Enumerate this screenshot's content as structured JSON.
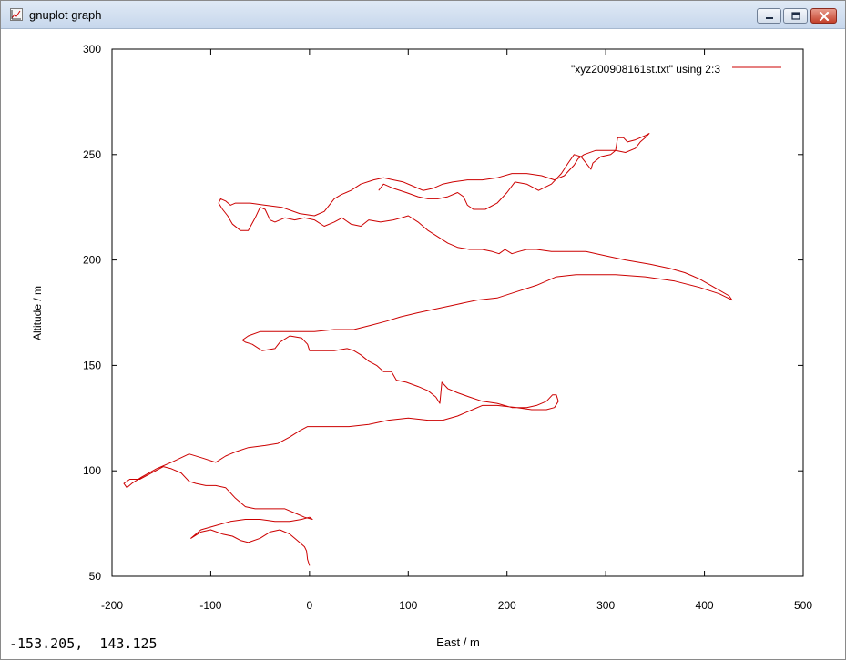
{
  "window": {
    "title": "gnuplot graph",
    "icon": "gnuplot-graph-icon",
    "controls": [
      "minimize-icon",
      "maximize-icon",
      "close-icon"
    ]
  },
  "status": {
    "mouse_coords": "-153.205,  143.125"
  },
  "chart_data": {
    "type": "line",
    "xlabel": "East / m",
    "ylabel": "Altitude / m",
    "xlim": [
      -200,
      500
    ],
    "ylim": [
      50,
      300
    ],
    "x_ticks": [
      "-200",
      "-100",
      "0",
      "100",
      "200",
      "300",
      "400",
      "500"
    ],
    "y_ticks": [
      "50",
      "100",
      "150",
      "200",
      "250",
      "300"
    ],
    "grid": false,
    "legend_position": "top-right",
    "series": [
      {
        "name": "\"xyz200908161st.txt\" using 2:3",
        "color": "#cc0000",
        "points": [
          [
            0,
            55
          ],
          [
            -2,
            58
          ],
          [
            -3,
            62
          ],
          [
            -5,
            64
          ],
          [
            -10,
            66
          ],
          [
            -15,
            68
          ],
          [
            -20,
            70
          ],
          [
            -30,
            72
          ],
          [
            -40,
            71
          ],
          [
            -50,
            68
          ],
          [
            -62,
            66
          ],
          [
            -70,
            67
          ],
          [
            -78,
            69
          ],
          [
            -88,
            70
          ],
          [
            -100,
            72
          ],
          [
            -110,
            71
          ],
          [
            -120,
            68
          ],
          [
            -110,
            72
          ],
          [
            -95,
            74
          ],
          [
            -80,
            76
          ],
          [
            -65,
            77
          ],
          [
            -50,
            77
          ],
          [
            -35,
            76
          ],
          [
            -20,
            76
          ],
          [
            -8,
            77
          ],
          [
            0,
            78
          ],
          [
            3,
            77
          ],
          [
            -5,
            78
          ],
          [
            -15,
            80
          ],
          [
            -25,
            82
          ],
          [
            -40,
            82
          ],
          [
            -55,
            82
          ],
          [
            -65,
            83
          ],
          [
            -75,
            87
          ],
          [
            -85,
            92
          ],
          [
            -95,
            93
          ],
          [
            -105,
            93
          ],
          [
            -115,
            94
          ],
          [
            -122,
            95
          ],
          [
            -130,
            99
          ],
          [
            -140,
            101
          ],
          [
            -148,
            102
          ],
          [
            -160,
            99
          ],
          [
            -172,
            96
          ],
          [
            -182,
            96
          ],
          [
            -188,
            94
          ],
          [
            -185,
            92
          ],
          [
            -180,
            94
          ],
          [
            -170,
            97
          ],
          [
            -155,
            101
          ],
          [
            -140,
            104
          ],
          [
            -122,
            108
          ],
          [
            -108,
            106
          ],
          [
            -95,
            104
          ],
          [
            -85,
            107
          ],
          [
            -75,
            109
          ],
          [
            -62,
            111
          ],
          [
            -45,
            112
          ],
          [
            -32,
            113
          ],
          [
            -20,
            116
          ],
          [
            -10,
            119
          ],
          [
            -2,
            121
          ],
          [
            15,
            121
          ],
          [
            40,
            121
          ],
          [
            60,
            122
          ],
          [
            80,
            124
          ],
          [
            100,
            125
          ],
          [
            120,
            124
          ],
          [
            135,
            124
          ],
          [
            150,
            126
          ],
          [
            165,
            129
          ],
          [
            175,
            131
          ],
          [
            190,
            131
          ],
          [
            210,
            130
          ],
          [
            225,
            129
          ],
          [
            240,
            129
          ],
          [
            248,
            130
          ],
          [
            252,
            133
          ],
          [
            250,
            136
          ],
          [
            246,
            136
          ],
          [
            240,
            133
          ],
          [
            230,
            131
          ],
          [
            220,
            130
          ],
          [
            205,
            130
          ],
          [
            190,
            132
          ],
          [
            175,
            133
          ],
          [
            162,
            135
          ],
          [
            150,
            137
          ],
          [
            140,
            139
          ],
          [
            134,
            142
          ],
          [
            133,
            137
          ],
          [
            132,
            132
          ],
          [
            128,
            135
          ],
          [
            120,
            138
          ],
          [
            110,
            140
          ],
          [
            98,
            142
          ],
          [
            88,
            143
          ],
          [
            83,
            147
          ],
          [
            75,
            147
          ],
          [
            68,
            150
          ],
          [
            60,
            152
          ],
          [
            52,
            155
          ],
          [
            45,
            157
          ],
          [
            38,
            158
          ],
          [
            25,
            157
          ],
          [
            10,
            157
          ],
          [
            0,
            157
          ],
          [
            -2,
            160
          ],
          [
            -8,
            163
          ],
          [
            -20,
            164
          ],
          [
            -30,
            161
          ],
          [
            -35,
            158
          ],
          [
            -48,
            157
          ],
          [
            -58,
            160
          ],
          [
            -65,
            161
          ],
          [
            -68,
            162
          ],
          [
            -62,
            164
          ],
          [
            -50,
            166
          ],
          [
            -35,
            166
          ],
          [
            -15,
            166
          ],
          [
            5,
            166
          ],
          [
            25,
            167
          ],
          [
            45,
            167
          ],
          [
            62,
            169
          ],
          [
            78,
            171
          ],
          [
            92,
            173
          ],
          [
            110,
            175
          ],
          [
            130,
            177
          ],
          [
            150,
            179
          ],
          [
            170,
            181
          ],
          [
            190,
            182
          ],
          [
            210,
            185
          ],
          [
            230,
            188
          ],
          [
            250,
            192
          ],
          [
            270,
            193
          ],
          [
            290,
            193
          ],
          [
            310,
            193
          ],
          [
            340,
            192
          ],
          [
            370,
            190
          ],
          [
            395,
            187
          ],
          [
            415,
            184
          ],
          [
            428,
            181
          ],
          [
            425,
            183
          ],
          [
            410,
            187
          ],
          [
            395,
            191
          ],
          [
            380,
            194
          ],
          [
            365,
            196
          ],
          [
            345,
            198
          ],
          [
            320,
            200
          ],
          [
            300,
            202
          ],
          [
            280,
            204
          ],
          [
            260,
            204
          ],
          [
            245,
            204
          ],
          [
            230,
            205
          ],
          [
            220,
            205
          ],
          [
            212,
            204
          ],
          [
            205,
            203
          ],
          [
            198,
            205
          ],
          [
            192,
            203
          ],
          [
            185,
            204
          ],
          [
            175,
            205
          ],
          [
            162,
            205
          ],
          [
            150,
            206
          ],
          [
            140,
            208
          ],
          [
            130,
            211
          ],
          [
            120,
            214
          ],
          [
            110,
            218
          ],
          [
            100,
            221
          ],
          [
            93,
            220
          ],
          [
            85,
            219
          ],
          [
            72,
            218
          ],
          [
            60,
            219
          ],
          [
            52,
            216
          ],
          [
            42,
            217
          ],
          [
            33,
            220
          ],
          [
            25,
            218
          ],
          [
            15,
            216
          ],
          [
            5,
            219
          ],
          [
            -5,
            220
          ],
          [
            -15,
            219
          ],
          [
            -25,
            220
          ],
          [
            -35,
            218
          ],
          [
            -40,
            219
          ],
          [
            -45,
            224
          ],
          [
            -50,
            225
          ],
          [
            -55,
            220
          ],
          [
            -62,
            214
          ],
          [
            -70,
            214
          ],
          [
            -78,
            217
          ],
          [
            -83,
            221
          ],
          [
            -88,
            224
          ],
          [
            -92,
            227
          ],
          [
            -90,
            229
          ],
          [
            -85,
            228
          ],
          [
            -80,
            226
          ],
          [
            -75,
            227
          ],
          [
            -60,
            227
          ],
          [
            -45,
            226
          ],
          [
            -28,
            225
          ],
          [
            -10,
            222
          ],
          [
            5,
            221
          ],
          [
            15,
            223
          ],
          [
            20,
            226
          ],
          [
            25,
            229
          ],
          [
            32,
            231
          ],
          [
            42,
            233
          ],
          [
            52,
            236
          ],
          [
            65,
            238
          ],
          [
            75,
            239
          ],
          [
            85,
            238
          ],
          [
            95,
            237
          ],
          [
            105,
            235
          ],
          [
            115,
            233
          ],
          [
            125,
            234
          ],
          [
            135,
            236
          ],
          [
            145,
            237
          ],
          [
            160,
            238
          ],
          [
            175,
            238
          ],
          [
            190,
            239
          ],
          [
            205,
            241
          ],
          [
            220,
            241
          ],
          [
            235,
            240
          ],
          [
            248,
            238
          ],
          [
            258,
            240
          ],
          [
            268,
            245
          ],
          [
            272,
            248
          ],
          [
            278,
            250
          ],
          [
            290,
            252
          ],
          [
            300,
            252
          ],
          [
            310,
            252
          ],
          [
            320,
            251
          ],
          [
            330,
            253
          ],
          [
            335,
            256
          ],
          [
            340,
            258
          ],
          [
            344,
            260
          ],
          [
            340,
            259
          ],
          [
            330,
            257
          ],
          [
            322,
            256
          ],
          [
            318,
            258
          ],
          [
            312,
            258
          ],
          [
            310,
            252
          ],
          [
            305,
            250
          ],
          [
            295,
            249
          ],
          [
            287,
            246
          ],
          [
            285,
            243
          ],
          [
            280,
            246
          ],
          [
            275,
            249
          ],
          [
            268,
            250
          ],
          [
            262,
            246
          ],
          [
            255,
            241
          ],
          [
            245,
            236
          ],
          [
            232,
            233
          ],
          [
            220,
            236
          ],
          [
            208,
            237
          ],
          [
            200,
            232
          ],
          [
            190,
            227
          ],
          [
            178,
            224
          ],
          [
            166,
            224
          ],
          [
            160,
            226
          ],
          [
            156,
            230
          ],
          [
            150,
            232
          ],
          [
            140,
            230
          ],
          [
            130,
            229
          ],
          [
            120,
            229
          ],
          [
            110,
            230
          ],
          [
            98,
            232
          ],
          [
            85,
            234
          ],
          [
            75,
            236
          ],
          [
            70,
            233
          ]
        ]
      }
    ]
  }
}
